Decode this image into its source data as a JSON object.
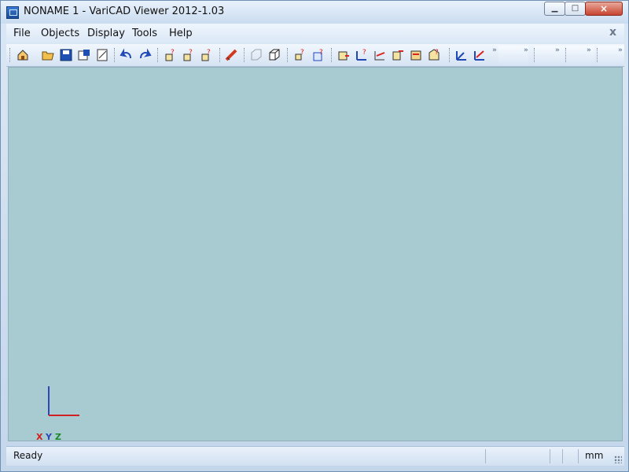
{
  "window": {
    "title": "NONAME 1 - VariCAD Viewer 2012-1.03"
  },
  "menu": {
    "items": [
      "File",
      "Objects",
      "Display",
      "Tools",
      "Help"
    ],
    "close_glyph": "x"
  },
  "toolbar": {
    "buttons": [
      "home-icon",
      "open-folder-icon",
      "save-icon",
      "save-as-icon",
      "print-icon",
      "undo-icon",
      "redo-icon",
      "query-object-icon",
      "query-point-icon",
      "query-distance-icon",
      "measure-icon",
      "wireframe-box-icon",
      "solid-box-icon",
      "selection-info-icon",
      "transform-info-icon",
      "rotate-icon",
      "move-icon",
      "dimension-icon",
      "section-icon",
      "material-icon",
      "mass-icon",
      "axes-icon",
      "axes-red-icon"
    ]
  },
  "canvas": {
    "background": "#a8cbd2",
    "axis_labels": [
      "X",
      "Y",
      "Z"
    ]
  },
  "status": {
    "message": "Ready",
    "units": "mm"
  }
}
